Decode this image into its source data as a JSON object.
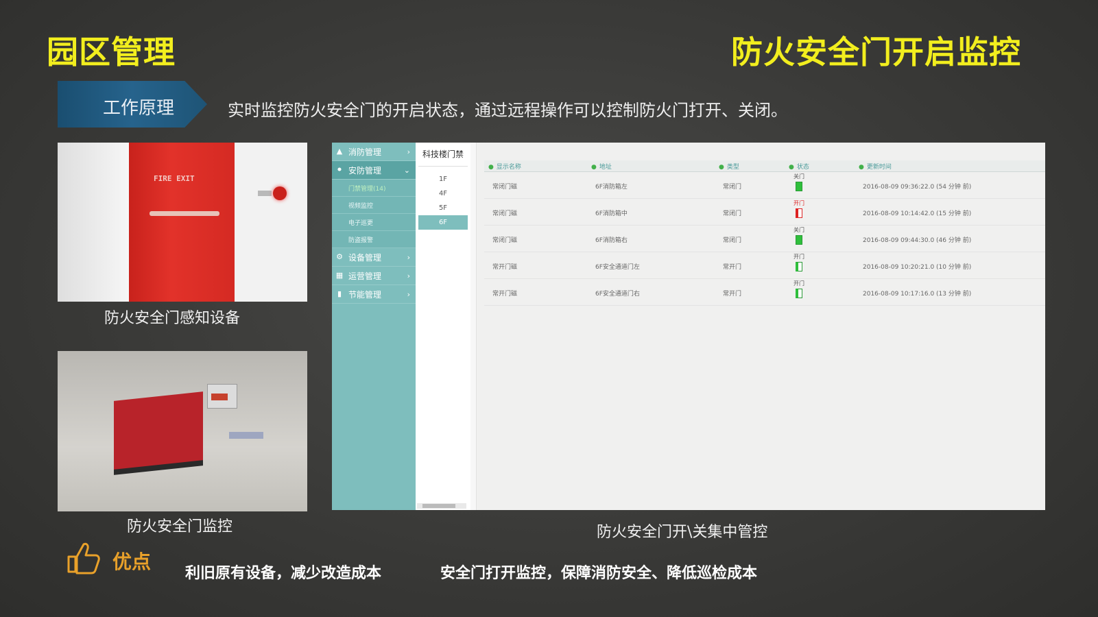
{
  "header": {
    "title_left": "园区管理",
    "title_right": "防火安全门开启监控"
  },
  "principle": {
    "tab_label": "工作原理",
    "description": "实时监控防火安全门的开启状态，通过远程操作可以控制防火门打开、关闭。"
  },
  "photos": {
    "photo1_caption": "防火安全门感知设备",
    "photo1_sign": "FIRE EXIT",
    "photo2_caption": "防火安全门监控"
  },
  "app": {
    "sidebar": {
      "items": [
        {
          "label": "消防管理",
          "icon": "fire-extinguisher-icon"
        },
        {
          "label": "安防管理",
          "icon": "shield-icon",
          "expanded": true
        },
        {
          "label": "设备管理",
          "icon": "gears-icon"
        },
        {
          "label": "运营管理",
          "icon": "grid-icon"
        },
        {
          "label": "节能管理",
          "icon": "battery-icon"
        }
      ],
      "subitems": [
        "门禁管理(14)",
        "视频监控",
        "电子巡更",
        "防盗报警"
      ]
    },
    "floors": {
      "header": "科技楼门禁",
      "items": [
        "1F",
        "4F",
        "5F",
        "6F"
      ],
      "selected": "6F"
    },
    "table": {
      "columns": [
        "显示名称",
        "地址",
        "类型",
        "状态",
        "更新时间"
      ],
      "rows": [
        {
          "name": "常闭门磁",
          "addr": "6F消防箱左",
          "type": "常闭门",
          "status": "关门",
          "state": "closed",
          "time": "2016-08-09 09:36:22.0 (54 分钟 前)"
        },
        {
          "name": "常闭门磁",
          "addr": "6F消防箱中",
          "type": "常闭门",
          "status": "开门",
          "state": "open-red",
          "time": "2016-08-09 10:14:42.0 (15 分钟 前)"
        },
        {
          "name": "常闭门磁",
          "addr": "6F消防箱右",
          "type": "常闭门",
          "status": "关门",
          "state": "closed",
          "time": "2016-08-09 09:44:30.0 (46 分钟 前)"
        },
        {
          "name": "常开门磁",
          "addr": "6F安全通道门左",
          "type": "常开门",
          "status": "开门",
          "state": "open",
          "time": "2016-08-09 10:20:21.0 (10 分钟 前)"
        },
        {
          "name": "常开门磁",
          "addr": "6F安全通道门右",
          "type": "常开门",
          "status": "开门",
          "state": "open",
          "time": "2016-08-09 10:17:16.0 (13 分钟 前)"
        }
      ]
    },
    "caption": "防火安全门开\\关集中管控"
  },
  "advantages": {
    "label": "优点",
    "item1": "利旧原有设备，减少改造成本",
    "item2": "安全门打开监控，保障消防安全、降低巡检成本"
  },
  "colors": {
    "title_yellow": "#f2ee1e",
    "tab_blue": "#1e5476",
    "sidebar_teal": "#7ebebd",
    "advantage_orange": "#e9a12a",
    "status_green": "#2fbf3c",
    "status_red": "#dd2222"
  }
}
